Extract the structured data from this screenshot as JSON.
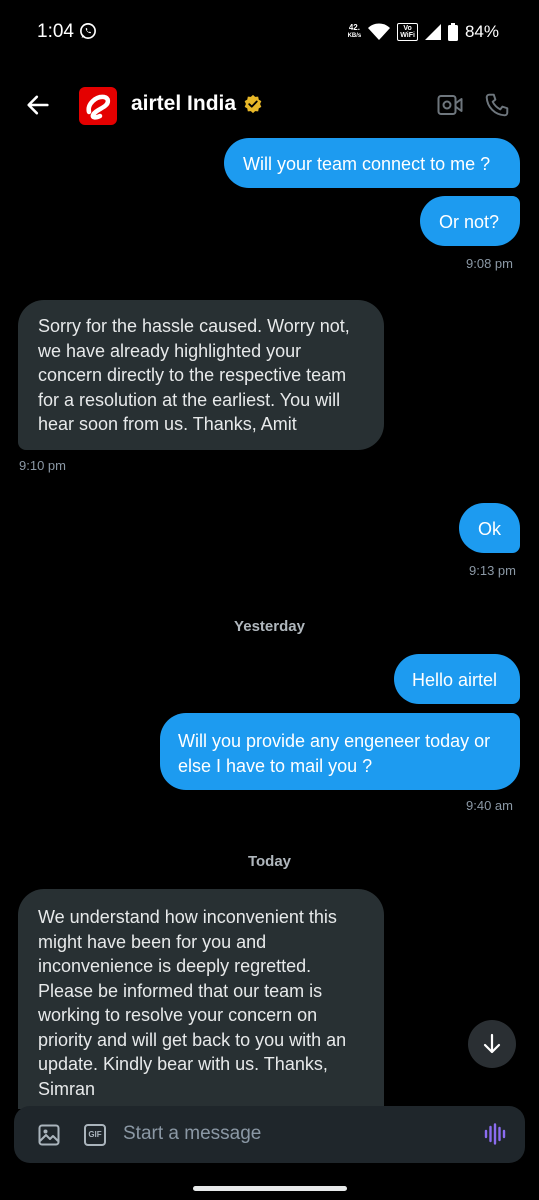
{
  "status": {
    "time": "1:04",
    "speed_value": "42.",
    "speed_unit": "KB/s",
    "vowifi_top": "Vo",
    "vowifi_bottom": "WiFi",
    "battery": "84%"
  },
  "header": {
    "title": "airtel India"
  },
  "messages": [
    {
      "text": "Will your team connect to me ?"
    },
    {
      "text": "Or not?",
      "time": "9:08 pm"
    },
    {
      "text": "Sorry for the hassle caused. Worry not, we have already highlighted your concern directly to the respective team for a resolution at the earliest. You will hear soon from us. Thanks, Amit",
      "time": "9:10 pm"
    },
    {
      "text": "Ok",
      "time": "9:13 pm"
    },
    {
      "text": "Hello airtel"
    },
    {
      "text": "Will you provide any engeneer today or else I have to mail you ?",
      "time": "9:40 am"
    },
    {
      "text": "We understand how inconvenient this might have been for you and inconvenience is deeply regretted. Please be informed that our team is working to resolve your concern on priority and will get back to you with an update. Kindly bear with us. Thanks, Simran"
    }
  ],
  "separators": {
    "yesterday": "Yesterday",
    "today": "Today"
  },
  "composer": {
    "placeholder": "Start a message",
    "gif_label": "GIF"
  },
  "colors": {
    "outgoing": "#1d9bf0",
    "incoming": "#283033",
    "background": "#000000"
  }
}
